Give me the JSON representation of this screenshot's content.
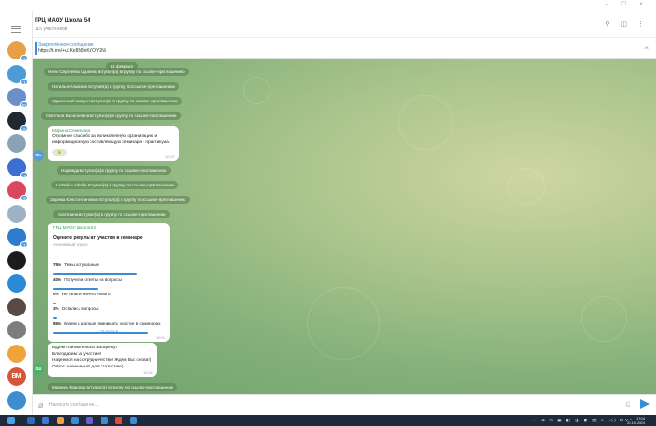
{
  "window": {
    "controls": "–  ☐  ✕"
  },
  "header": {
    "title": "ГРЦ МАОУ Школа 54",
    "subtitle": "115 участников",
    "icons": [
      "search-icon",
      "columns-icon",
      "more-vert-icon"
    ]
  },
  "pinned": {
    "title": "Закреплённое сообщение",
    "text": "https://t.me/+u1Ke8B8nKYOY2Ni"
  },
  "sidebar": {
    "chats": [
      {
        "color": "#e7a04a",
        "badge": "9"
      },
      {
        "color": "#4c9bd6",
        "badge": "1"
      },
      {
        "color": "#6c8ec9",
        "badge": "55"
      },
      {
        "color": "#222831",
        "badge": "8"
      },
      {
        "color": "#8aa2b5",
        "badge": ""
      },
      {
        "color": "#3c6fd1",
        "badge": "4"
      },
      {
        "color": "#d9485f",
        "badge": "9"
      },
      {
        "color": "#9fb2c4",
        "badge": ""
      },
      {
        "color": "#2f7ccf",
        "badge": "2"
      },
      {
        "color": "#1c1c1c",
        "badge": ""
      },
      {
        "color": "#2b8ad6",
        "badge": ""
      },
      {
        "color": "#5a4a44",
        "badge": ""
      },
      {
        "color": "#7d7d7d",
        "badge": ""
      },
      {
        "color": "#f0a23b",
        "badge": ""
      },
      {
        "color": "#d5573b",
        "initials": "ВМ",
        "badge": ""
      },
      {
        "color": "#3f8ccf",
        "badge": ""
      }
    ]
  },
  "messages": {
    "date": "11 февраля",
    "svc1": "Нели Сергеевна Цыкина вступил(а) в группу по ссылке-приглашению",
    "svc2": "Наталья Алыкина вступил(а) в группу по ссылке-приглашению",
    "svc3": "Удаленный аккаунт вступил(а) в группу по ссылке-приглашению",
    "svc4": "Светлана Васильевна вступил(а) в группу по ссылке-приглашению",
    "m1_name": "Марина Семёнова",
    "m1_line1": "Огромное спасибо за великолепную организацию и",
    "m1_line2": "информационную составляющую семинара - практикума.",
    "m1_reaction": "👍",
    "m1_time": "10:27",
    "m1_avatar": "МС",
    "svc5": "Надежда вступил(а) в группу по ссылке-приглашению",
    "svc6": "Ludmila Ludmila вступил(а) в группу по ссылке-приглашению",
    "svc7": "Зарема Константиновна вступил(а) в группу по ссылке-приглашению",
    "svc8": "Екатерина вступил(а) в группу по ссылке-приглашению",
    "svc9": "Марина Иванова вступил(а) в группу по ссылке-приглашению",
    "m3_line1": "Будем признательны за оценку!",
    "m3_line2": "Благодарим за участие!",
    "m3_line3": "Надеемся на сотрудничество! Ждём Вас снова!)",
    "m3_line4": "Опрос анонимный, для статистики)",
    "m3_time": "10:31",
    "m3_avatar": "ГШ"
  },
  "poll": {
    "sender": "ГРЦ МАОУ Школа 54",
    "question": "Оцените результат участия в семинаре",
    "type": "Анонимный опрос",
    "options": [
      {
        "pct": "75%",
        "label": "Темы актуальные",
        "value": 0.75
      },
      {
        "pct": "40%",
        "label": "Получили ответы на вопросы",
        "value": 0.4
      },
      {
        "pct": "0%",
        "label": "Не узнали ничего нового",
        "value": 0.0
      },
      {
        "pct": "3%",
        "label": "Остались вопросы",
        "value": 0.03
      },
      {
        "pct": "85%",
        "label": "Будем и дальше принимать участие в семинарах",
        "value": 0.85
      }
    ],
    "votes": "33 голоса",
    "time": "10:31"
  },
  "composer": {
    "placeholder": "Написать сообщение..."
  },
  "taskbar": {
    "tray": "▲ ⊕ ⊙ ▣ ◧ ◪ ◩ ▤ ∿ ◁) РУС",
    "time": "17:04",
    "date": "25.10.2024",
    "app_colors": [
      "#2d6db5",
      "#3b7bd6",
      "#f0a23b",
      "#3a8dd4",
      "#6c5fd6",
      "#3a8dd4",
      "#e04b3b",
      "#3a8dd4"
    ]
  },
  "colors": {
    "accent": "#3a8dd4",
    "green": "#3aa35a"
  }
}
